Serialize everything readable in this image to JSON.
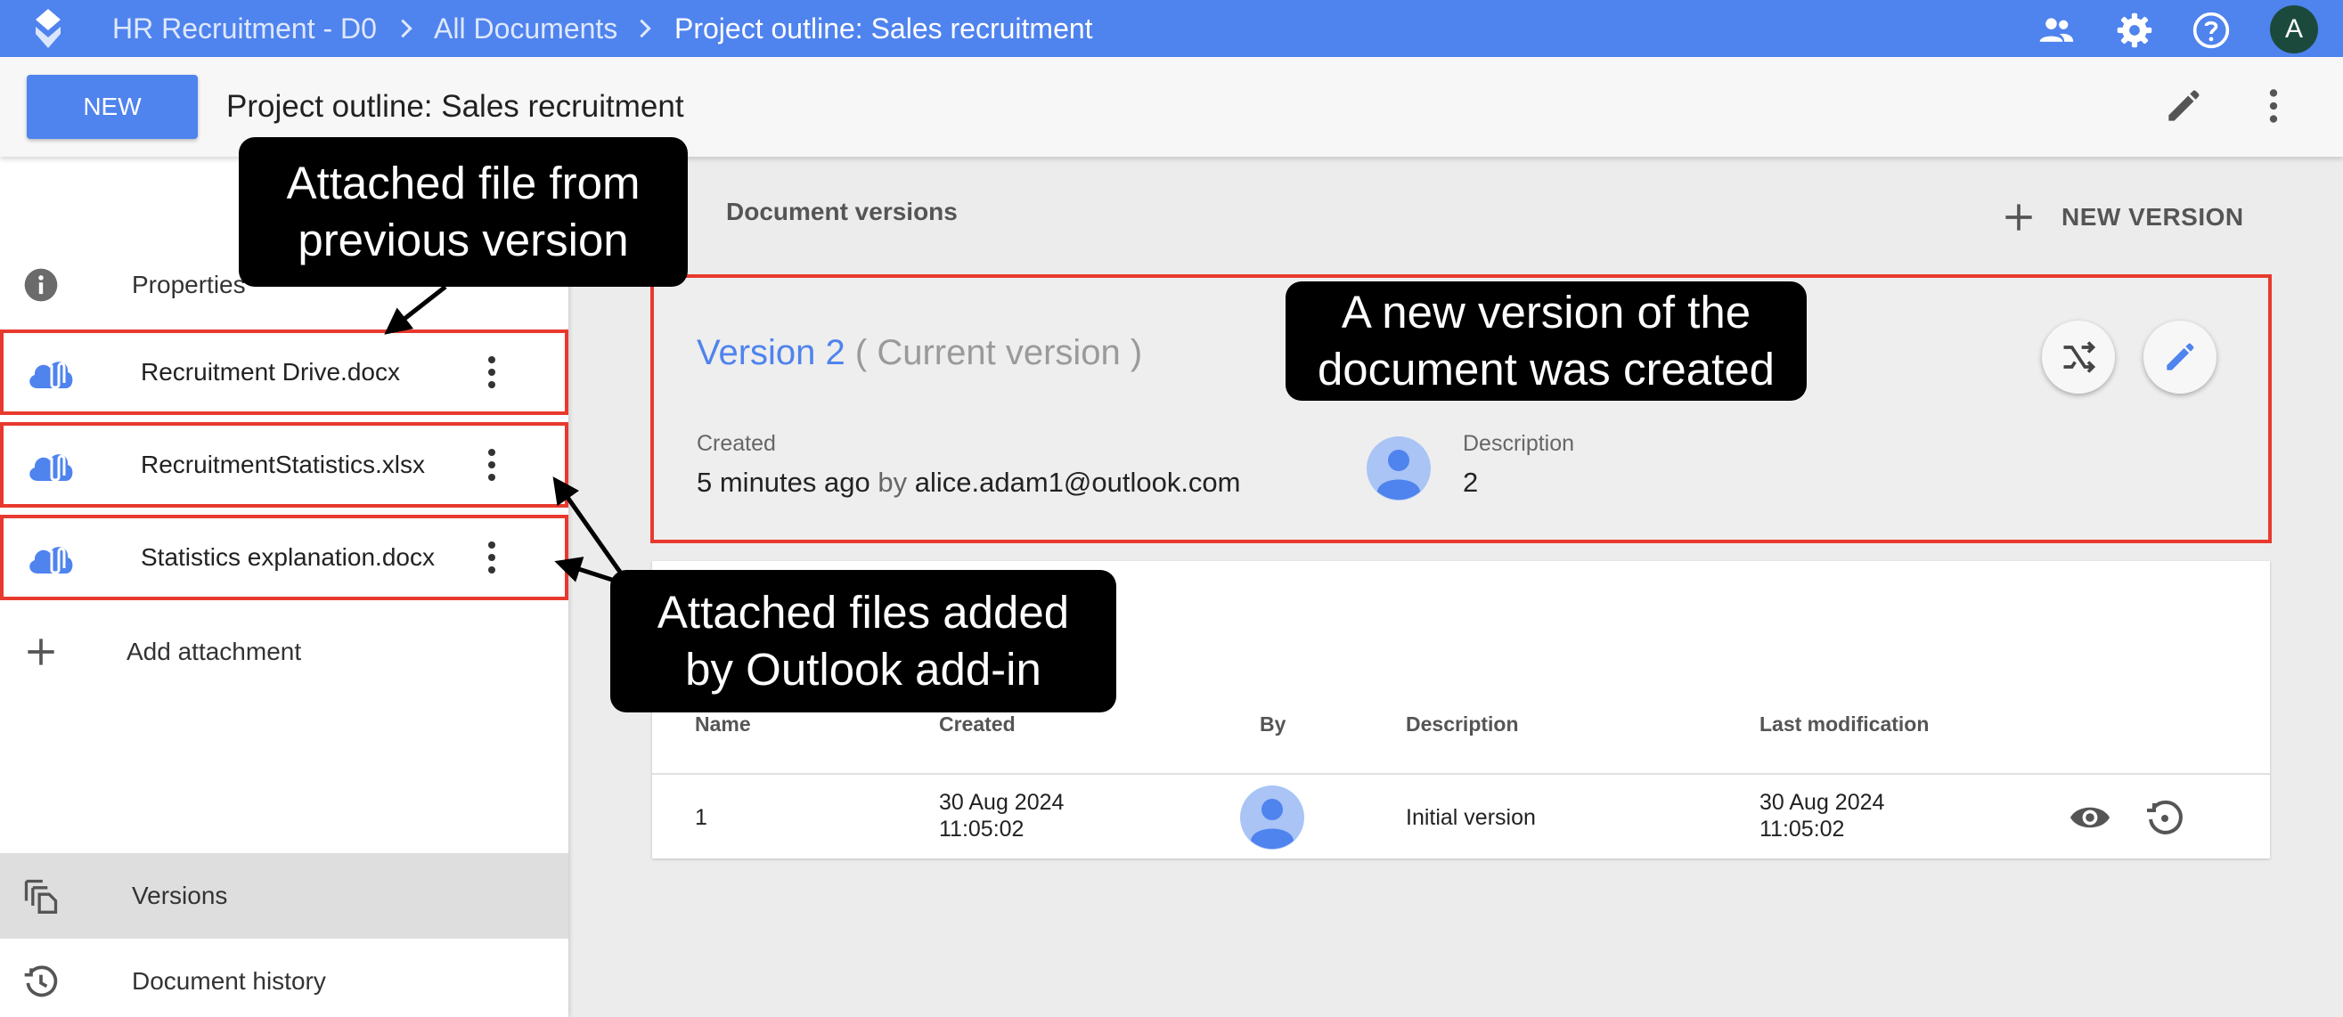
{
  "topbar": {
    "breadcrumbs": [
      "HR Recruitment - D0",
      "All Documents",
      "Project outline: Sales recruitment"
    ],
    "avatar_letter": "A",
    "icons": [
      "people-icon",
      "gear-icon",
      "help-icon"
    ],
    "color": "#4f83ee"
  },
  "subbar": {
    "new_label": "NEW",
    "title": "Project outline: Sales recruitment"
  },
  "sidebar": {
    "properties_label": "Properties",
    "attachments": [
      {
        "name": "Recruitment Drive.docx"
      },
      {
        "name": "RecruitmentStatistics.xlsx"
      },
      {
        "name": "Statistics explanation.docx"
      }
    ],
    "add_attachment_label": "Add attachment",
    "versions_label": "Versions",
    "history_label": "Document history"
  },
  "versions": {
    "section_title": "Document versions",
    "new_version_label": "NEW VERSION",
    "current": {
      "name": "Version 2",
      "current_label": "( Current version )",
      "created_label": "Created",
      "created_ago": "5 minutes ago",
      "by_word": "by",
      "created_by": "alice.adam1@outlook.com",
      "description_label": "Description",
      "description": "2"
    },
    "table": {
      "headers": [
        "Name",
        "Created",
        "By",
        "Description",
        "Last modification"
      ],
      "rows": [
        {
          "name": "1",
          "created_date": "30 Aug 2024",
          "created_time": "11:05:02",
          "description": "Initial version",
          "modified_date": "30 Aug 2024",
          "modified_time": "11:05:02"
        }
      ]
    }
  },
  "callouts": {
    "previous_version_line1": "Attached file from",
    "previous_version_line2": "previous version",
    "new_version_line1": "A new version of the",
    "new_version_line2": "document was created",
    "addin_line1": "Attached files added",
    "addin_line2": "by Outlook add-in"
  }
}
